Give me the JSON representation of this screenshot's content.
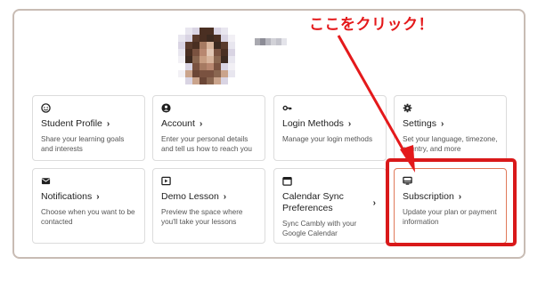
{
  "annotation": {
    "callout_text": "ここをクリック！",
    "color": "#e4191b"
  },
  "colors": {
    "panel_border": "#c8bcb4",
    "card_border": "#dcdcdc",
    "highlight_border": "#d9191a"
  },
  "cards": [
    {
      "icon": "face-icon",
      "title": "Student Profile",
      "desc": "Share your learning goals and interests"
    },
    {
      "icon": "person-icon",
      "title": "Account",
      "desc": "Enter your personal details and tell us how to reach you"
    },
    {
      "icon": "key-icon",
      "title": "Login Methods",
      "desc": "Manage your login methods"
    },
    {
      "icon": "gear-icon",
      "title": "Settings",
      "desc": "Set your language, timezone, country, and more"
    },
    {
      "icon": "mail-icon",
      "title": "Notifications",
      "desc": "Choose when you want to be contacted"
    },
    {
      "icon": "video-icon",
      "title": "Demo Lesson",
      "desc": "Preview the space where you'll take your lessons"
    },
    {
      "icon": "calendar-icon",
      "title": "Calendar Sync Preferences",
      "desc": "Sync Cambly with your Google Calendar"
    },
    {
      "icon": "monitor-icon",
      "title": "Subscription",
      "desc": "Update your plan or payment information"
    }
  ],
  "chevron": "›"
}
